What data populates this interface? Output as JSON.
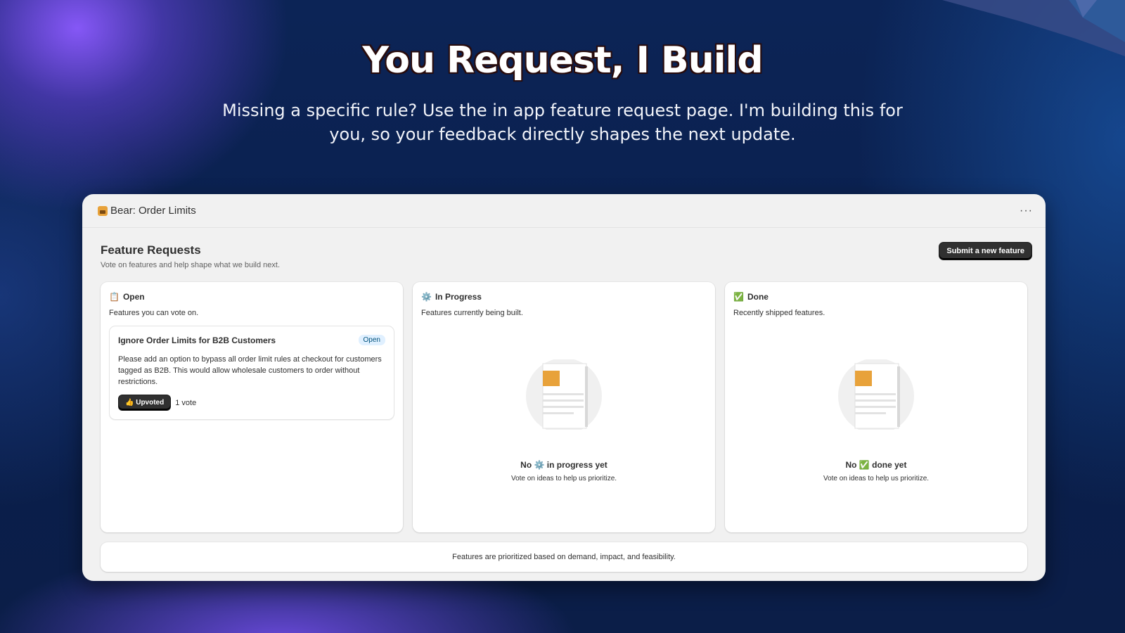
{
  "hero": {
    "title": "You Request, I Build",
    "subtitle": "Missing a specific rule? Use the in app feature request page. I'm building this for you, so your feedback directly shapes the next update."
  },
  "app": {
    "title": "Bear: Order Limits",
    "more_label": "···"
  },
  "page": {
    "title": "Feature Requests",
    "description": "Vote on features and help shape what we build next.",
    "submit_label": "Submit a new feature"
  },
  "columns": [
    {
      "emoji": "📋",
      "title": "Open",
      "description": "Features you can vote on.",
      "cards": [
        {
          "title": "Ignore Order Limits for B2B Customers",
          "badge": "Open",
          "body": "Please add an option to bypass all order limit rules at checkout for customers tagged as B2B. This would allow wholesale customers to order without restrictions.",
          "upvote_label": "👍 Upvoted",
          "votes": "1 vote"
        }
      ]
    },
    {
      "emoji": "⚙️",
      "title": "In Progress",
      "description": "Features currently being built.",
      "empty_title": "No ⚙️ in progress yet",
      "empty_desc": "Vote on ideas to help us prioritize."
    },
    {
      "emoji": "✅",
      "title": "Done",
      "description": "Recently shipped features.",
      "empty_title": "No ✅ done yet",
      "empty_desc": "Vote on ideas to help us prioritize."
    }
  ],
  "footer": {
    "text": "Features are prioritized based on demand, impact, and feasibility."
  },
  "colors": {
    "background": "#0a1f4a",
    "glow_purple": "#8c5aff",
    "window_bg": "#f1f1f1",
    "primary_button": "#303030",
    "badge_bg": "#e0f0ff",
    "illustration_accent": "#e8a23a"
  }
}
